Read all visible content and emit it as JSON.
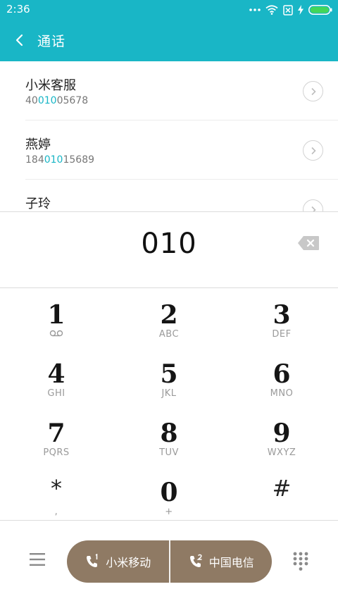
{
  "status_bar": {
    "time": "2:36",
    "icons": [
      "more-dots-icon",
      "wifi-icon",
      "sim-disabled-icon",
      "charging-icon",
      "battery-icon"
    ]
  },
  "header": {
    "title": "通话",
    "back_icon": "back-arrow-icon",
    "background_color": "#19b6c6"
  },
  "results": [
    {
      "name": "小米客服",
      "number_before": "40",
      "number_match": "010",
      "number_after": "05678"
    },
    {
      "name": "燕婷",
      "number_before": "184",
      "number_match": "010",
      "number_after": "15689"
    },
    {
      "name": "子玲",
      "number_before": "",
      "number_match": "",
      "number_after": ""
    }
  ],
  "dial_input": {
    "value": "010",
    "backspace_icon": "backspace-icon"
  },
  "keypad": {
    "keys": [
      {
        "digit": "1",
        "letters": ""
      },
      {
        "digit": "2",
        "letters": "ABC"
      },
      {
        "digit": "3",
        "letters": "DEF"
      },
      {
        "digit": "4",
        "letters": "GHI"
      },
      {
        "digit": "5",
        "letters": "JKL"
      },
      {
        "digit": "6",
        "letters": "MNO"
      },
      {
        "digit": "7",
        "letters": "PQRS"
      },
      {
        "digit": "8",
        "letters": "TUV"
      },
      {
        "digit": "9",
        "letters": "WXYZ"
      },
      {
        "digit": "*",
        "letters": ","
      },
      {
        "digit": "0",
        "letters": "+"
      },
      {
        "digit": "#",
        "letters": ""
      }
    ],
    "voicemail_icon": "voicemail-icon"
  },
  "bottom_bar": {
    "menu_icon": "menu-icon",
    "dialpad_icon": "dialpad-grid-icon",
    "call_buttons": [
      {
        "label": "小米移动",
        "sim": "1"
      },
      {
        "label": "中国电信",
        "sim": "2"
      }
    ],
    "call_color": "#8f7a64"
  }
}
